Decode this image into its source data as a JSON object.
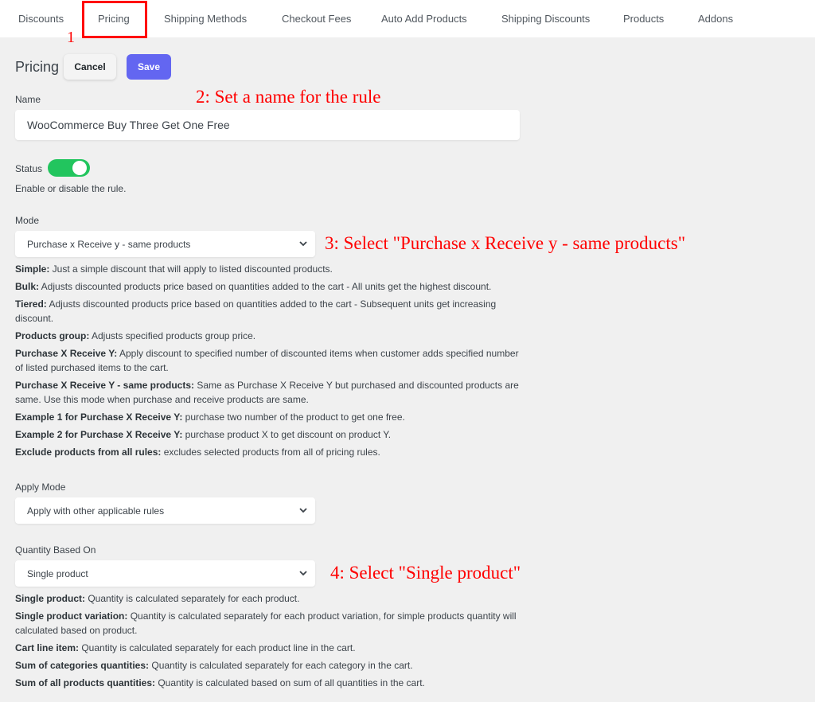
{
  "tabs": [
    "Discounts",
    "Pricing",
    "Shipping Methods",
    "Checkout Fees",
    "Auto Add Products",
    "Shipping Discounts",
    "Products",
    "Addons"
  ],
  "active_tab": "Pricing",
  "annotations": {
    "a1": "1",
    "a2": "2: Set a name for the rule",
    "a3": "3: Select \"Purchase x Receive y - same products\"",
    "a4": "4: Select \"Single product\"",
    "color": "#ff0000"
  },
  "header": {
    "title": "Pricing",
    "cancel": "Cancel",
    "save": "Save",
    "accent": "#6366f1"
  },
  "name": {
    "label": "Name",
    "value": "WooCommerce Buy Three Get One Free"
  },
  "status": {
    "label": "Status",
    "enabled": true,
    "help": "Enable or disable the rule.",
    "color": "#22c55e"
  },
  "mode": {
    "label": "Mode",
    "value": "Purchase x Receive y - same products",
    "help": [
      {
        "term": "Simple:",
        "text": " Just a simple discount that will apply to listed discounted products."
      },
      {
        "term": "Bulk:",
        "text": " Adjusts discounted products price based on quantities added to the cart - All units get the highest discount."
      },
      {
        "term": "Tiered:",
        "text": " Adjusts discounted products price based on quantities added to the cart - Subsequent units get increasing discount."
      },
      {
        "term": "Products group:",
        "text": " Adjusts specified products group price."
      },
      {
        "term": "Purchase X Receive Y:",
        "text": " Apply discount to specified number of discounted items when customer adds specified number of listed purchased items to the cart."
      },
      {
        "term": "Purchase X Receive Y - same products:",
        "text": " Same as Purchase X Receive Y but purchased and discounted products are same. Use this mode when purchase and receive products are same."
      },
      {
        "term": "Example 1 for Purchase X Receive Y:",
        "text": " purchase two number of the product to get one free."
      },
      {
        "term": "Example 2 for Purchase X Receive Y:",
        "text": " purchase product X to get discount on product Y."
      },
      {
        "term": "Exclude products from all rules:",
        "text": " excludes selected products from all of pricing rules."
      }
    ]
  },
  "apply_mode": {
    "label": "Apply Mode",
    "value": "Apply with other applicable rules"
  },
  "quantity": {
    "label": "Quantity Based On",
    "value": "Single product",
    "help": [
      {
        "term": "Single product:",
        "text": " Quantity is calculated separately for each product."
      },
      {
        "term": "Single product variation:",
        "text": " Quantity is calculated separately for each product variation, for simple products quantity will calculated based on product."
      },
      {
        "term": "Cart line item:",
        "text": " Quantity is calculated separately for each product line in the cart."
      },
      {
        "term": "Sum of categories quantities:",
        "text": " Quantity is calculated separately for each category in the cart."
      },
      {
        "term": "Sum of all products quantities:",
        "text": " Quantity is calculated based on sum of all quantities in the cart."
      }
    ]
  }
}
